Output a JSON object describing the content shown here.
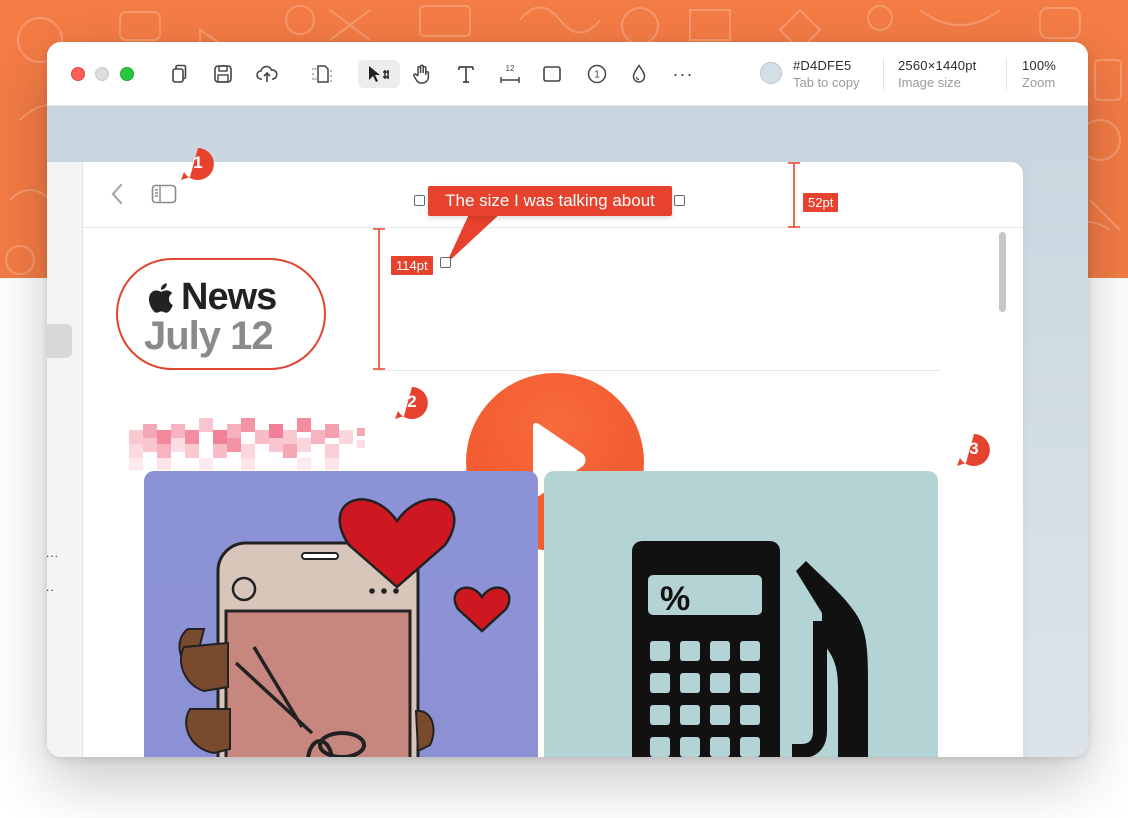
{
  "toolbar": {
    "color_value": "#D4DFE5",
    "color_hint": "Tab to copy",
    "size_value": "2560×1440pt",
    "size_label": "Image size",
    "zoom_value": "100%",
    "zoom_label": "Zoom",
    "tools": [
      "copy-icon",
      "save-icon",
      "cloud-upload-icon",
      "crop-icon",
      "select-icon",
      "hand-icon",
      "text-icon",
      "measure-icon",
      "rectangle-icon",
      "counter-icon",
      "blur-icon",
      "more-icon"
    ],
    "measure_tool_label": "12",
    "counter_tool_label": "1",
    "more_label": "···"
  },
  "inner": {
    "news_title": "News",
    "news_date": "July 12",
    "sidebar_dots_1": "...",
    "sidebar_dots_2": ".."
  },
  "annotations": {
    "callout_text": "The size I was talking about",
    "measure_header": "52pt",
    "measure_logo": "114pt",
    "bubbles": [
      "1",
      "2",
      "3"
    ]
  },
  "colors": {
    "accent": "#E6422D",
    "banner": "#F47C45",
    "canvas": "#D4DFE5"
  }
}
